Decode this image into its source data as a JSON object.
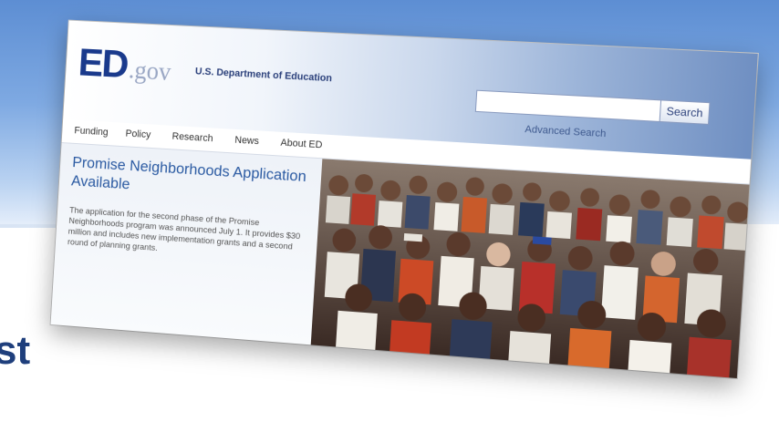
{
  "site": {
    "logo_ed": "ED",
    "logo_gov": ".gov",
    "department": "U.S. Department of Education"
  },
  "search": {
    "value": "",
    "button_label": "Search",
    "advanced_label": "Advanced Search"
  },
  "nav": {
    "items": [
      {
        "label": "Funding"
      },
      {
        "label": "Policy"
      },
      {
        "label": "Research"
      },
      {
        "label": "News"
      },
      {
        "label": "About ED"
      }
    ]
  },
  "feature": {
    "title": "Promise Neighborhoods Application Available",
    "body": "The application for the second phase of the Promise Neighborhoods program was announced July 1. It provides $30 million and includes new implementation grants and a second round of planning grants."
  },
  "slide": {
    "bottom_text": "st"
  },
  "colors": {
    "slide_blue": "#5d8ed3",
    "ed_blue": "#1a3a8c",
    "feature_title": "#2b5aa2",
    "slide_text": "#1f3f7c"
  }
}
